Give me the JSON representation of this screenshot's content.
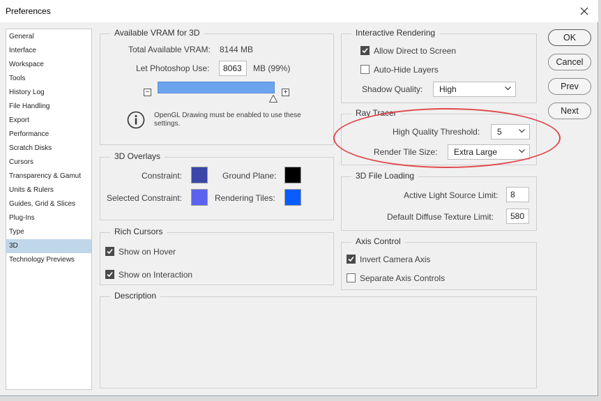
{
  "window": {
    "title": "Preferences"
  },
  "sidebar": {
    "items": [
      {
        "label": "General"
      },
      {
        "label": "Interface"
      },
      {
        "label": "Workspace"
      },
      {
        "label": "Tools"
      },
      {
        "label": "History Log"
      },
      {
        "label": "File Handling"
      },
      {
        "label": "Export"
      },
      {
        "label": "Performance"
      },
      {
        "label": "Scratch Disks"
      },
      {
        "label": "Cursors"
      },
      {
        "label": "Transparency & Gamut"
      },
      {
        "label": "Units & Rulers"
      },
      {
        "label": "Guides, Grid & Slices"
      },
      {
        "label": "Plug-Ins"
      },
      {
        "label": "Type"
      },
      {
        "label": "3D"
      },
      {
        "label": "Technology Previews"
      }
    ],
    "selected": "3D"
  },
  "vram": {
    "title": "Available VRAM for 3D",
    "total_label": "Total Available VRAM:",
    "total_value": "8144 MB",
    "use_label": "Let Photoshop Use:",
    "use_value": "8063",
    "use_unit": "MB (99%)",
    "slider_fraction": 0.99,
    "minus": "−",
    "plus": "+",
    "info_text_line1": "OpenGL Drawing must be enabled to use these",
    "info_text_line2": "settings."
  },
  "overlays": {
    "title": "3D Overlays",
    "constraint_label": "Constraint:",
    "ground_plane_label": "Ground Plane:",
    "selected_constraint_label": "Selected Constraint:",
    "rendering_tiles_label": "Rendering Tiles:",
    "colors": {
      "constraint": "#3a47a8",
      "ground_plane": "#000000",
      "selected_constraint": "#5b62f0",
      "rendering_tiles": "#0b5cff"
    }
  },
  "rich_cursors": {
    "title": "Rich Cursors",
    "show_on_hover": "Show on Hover",
    "show_on_hover_checked": true,
    "show_on_interaction": "Show on Interaction",
    "show_on_interaction_checked": true
  },
  "description": {
    "title": "Description"
  },
  "interactive_rendering": {
    "title": "Interactive Rendering",
    "allow_direct": "Allow Direct to Screen",
    "allow_direct_checked": true,
    "auto_hide": "Auto-Hide Layers",
    "auto_hide_checked": false,
    "shadow_quality_label": "Shadow Quality:",
    "shadow_quality_value": "High"
  },
  "ray_tracer": {
    "title": "Ray Tracer",
    "threshold_label": "High Quality Threshold:",
    "threshold_value": "5",
    "tile_size_label": "Render Tile Size:",
    "tile_size_value": "Extra Large"
  },
  "file_loading": {
    "title": "3D File Loading",
    "light_label": "Active Light Source Limit:",
    "light_value": "8",
    "texture_label": "Default Diffuse Texture Limit:",
    "texture_value": "580"
  },
  "axis_control": {
    "title": "Axis Control",
    "invert": "Invert Camera Axis",
    "invert_checked": true,
    "separate": "Separate Axis Controls",
    "separate_checked": false
  },
  "buttons": {
    "ok": "OK",
    "cancel": "Cancel",
    "prev": "Prev",
    "next": "Next"
  }
}
